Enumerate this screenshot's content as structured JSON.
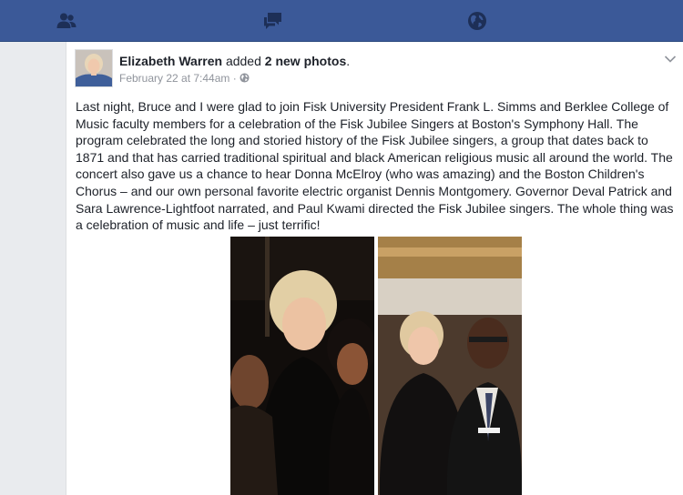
{
  "topbar": {
    "background": "#3b5998",
    "icons": [
      "friends-icon",
      "messages-icon",
      "globe-notifications-icon"
    ]
  },
  "post": {
    "author_name": "Elizabeth Warren",
    "action_text": " added ",
    "photo_count": "2 new photos",
    "period": ".",
    "timestamp": "February 22 at 7:44am",
    "separator": "·",
    "audience_icon": "public-globe-icon",
    "body": "Last night, Bruce and I were glad to join Fisk University President Frank L. Simms and Berklee College of Music faculty members for a celebration of the Fisk Jubilee Singers at Boston's Symphony Hall. The program celebrated the long and storied history of the Fisk Jubilee singers, a group that dates back to 1871 and that has carried traditional spiritual and black American religious music all around the world. The concert also gave us a chance to hear Donna McElroy (who was amazing) and the Boston Children's Chorus – and our own personal favorite electric organist Dennis Montgomery. Governor Deval Patrick and Sara Lawrence-Lightfoot narrated, and Paul Kwami directed the Fisk Jubilee singers. The whole thing was a celebration of music and life – just terrific!"
  }
}
